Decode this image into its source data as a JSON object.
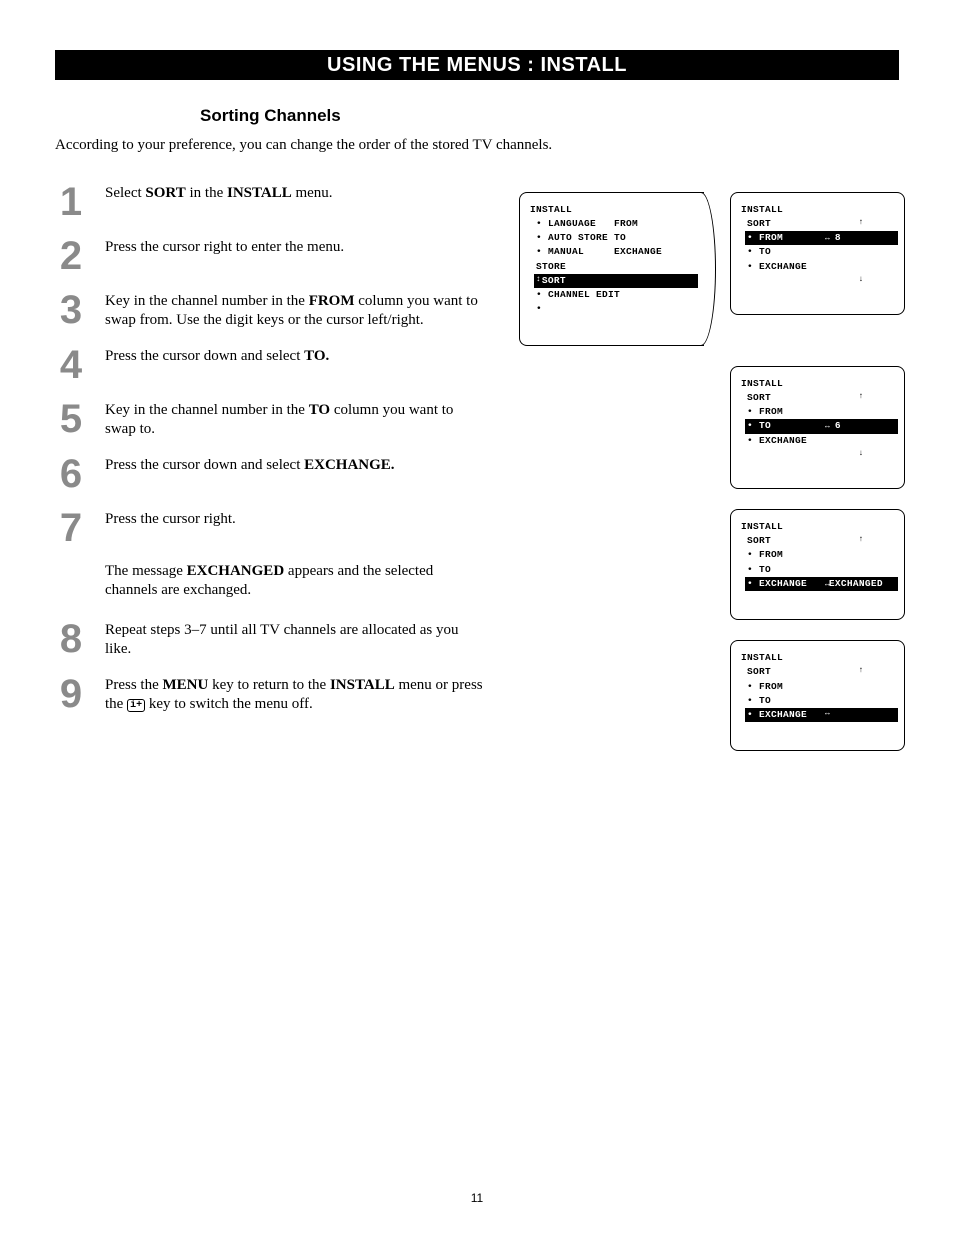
{
  "titleBar": "USING THE MENUS : INSTALL",
  "sectionTitle": "Sorting Channels",
  "intro": "According to your preference, you can change the order of the stored TV channels.",
  "steps": [
    {
      "num": "1",
      "html": "Select <b>SORT</b> in the <b>INSTALL</b> menu."
    },
    {
      "num": "2",
      "html": "Press the cursor right to enter the menu."
    },
    {
      "num": "3",
      "html": "Key in the channel number in the <b>FROM</b> column you want to swap from. Use the digit keys or the cursor left/right."
    },
    {
      "num": "4",
      "html": "Press the cursor down and select <b>TO.</b>"
    },
    {
      "num": "5",
      "html": "Key in the channel number in the <b>TO</b> column you want to swap to."
    },
    {
      "num": "6",
      "html": "Press the cursor down and select <b>EXCHANGE.</b>"
    },
    {
      "num": "7",
      "html": "Press the cursor right."
    }
  ],
  "note": "The message <b>EXCHANGED</b> appears and the selected channels are exchanged.",
  "stepsAfter": [
    {
      "num": "8",
      "html": "Repeat steps 3–7 until all TV channels are allocated as you like."
    },
    {
      "num": "9",
      "html": "Press the <b>MENU</b> key to return to the <b>INSTALL</b> menu or press the <span class=\"info-icon\">i+</span> key to switch the menu off."
    }
  ],
  "osd": {
    "install": "INSTALL",
    "sort": "SORT",
    "language": "• LANGUAGE",
    "autoStore": "• AUTO STORE",
    "manualStore": "• MANUAL STORE",
    "sortItem": "SORT",
    "channelEdit": "• CHANNEL EDIT",
    "from": "FROM",
    "to": "TO",
    "exchange": "EXCHANGE",
    "fromDot": "• FROM",
    "toDot": "• TO",
    "exchangeDot": "• EXCHANGE",
    "val8": "8",
    "val6": "6",
    "exchanged": "EXCHANGED",
    "updown": "↕",
    "leftright": "↔",
    "down": "↓",
    "up": "↑"
  },
  "pageNumber": "11"
}
